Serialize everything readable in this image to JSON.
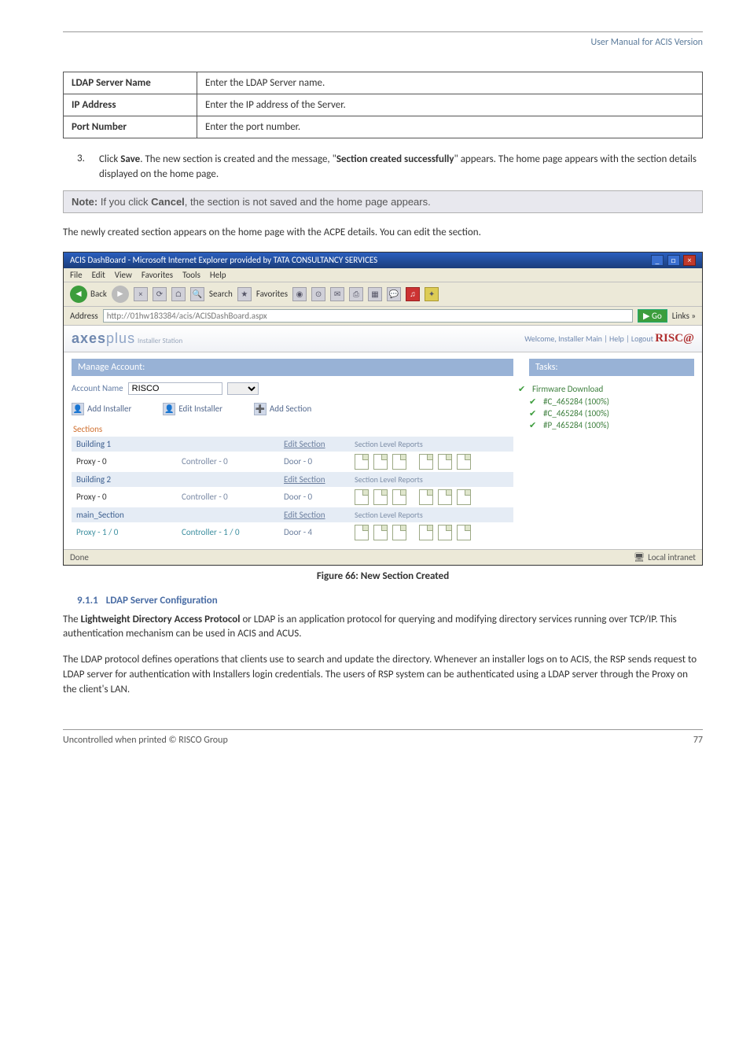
{
  "header": {
    "manual_title": "User Manual for ACIS Version"
  },
  "params": [
    {
      "name": "LDAP Server Name",
      "desc": "Enter the LDAP Server name."
    },
    {
      "name": "IP Address",
      "desc": "Enter the IP address of the Server."
    },
    {
      "name": "Port Number",
      "desc": "Enter the port number."
    }
  ],
  "step": {
    "num": "3.",
    "bold1": "Save",
    "mid": "The new section is created and the message,",
    "bold2": "Section created successfully",
    "tail": "appears. The home page appears with the section details displayed on the home page."
  },
  "note": {
    "label": "Note:",
    "pre": "If you click",
    "bold": "Cancel",
    "post": ", the section is not saved and the home page appears."
  },
  "para_after_note": "The newly created section appears on the home page with the ACPE details. You can edit the section.",
  "ss": {
    "title": "ACIS DashBoard - Microsoft Internet Explorer provided by TATA CONSULTANCY SERVICES",
    "menu": [
      "File",
      "Edit",
      "View",
      "Favorites",
      "Tools",
      "Help"
    ],
    "back": "Back",
    "search": "Search",
    "favorites": "Favorites",
    "address_label": "Address",
    "url": "http://01hw183384/acis/ACISDashBoard.aspx",
    "go": "Go",
    "links": "Links »",
    "brand_sub": "Installer Station",
    "welcome": "Welcome, Installer Main | Help | Logout",
    "risco": "RISC@",
    "manage_hdr": "Manage Account:",
    "acct_label": "Account Name",
    "acct_value": "RISCO",
    "add_installer": "Add Installer",
    "edit_installer": "Edit Installer",
    "add_section": "Add Section",
    "sections_hdr": "Sections",
    "edit_section": "Edit Section",
    "sec_reports": "Section Level Reports",
    "rows": [
      {
        "name": "Building 1",
        "proxy": "Proxy - 0",
        "ctrl": "Controller - 0",
        "door": "Door - 0"
      },
      {
        "name": "Building 2",
        "proxy": "Proxy - 0",
        "ctrl": "Controller - 0",
        "door": "Door - 0"
      },
      {
        "name": "main_Section",
        "proxy": "Proxy - 1 / 0",
        "ctrl": "Controller - 1 / 0",
        "door": "Door - 4"
      }
    ],
    "tasks_hdr": "Tasks:",
    "tasks": [
      "Firmware Download",
      "#C_465284 (100%)",
      "#C_465284 (100%)",
      "#P_465284 (100%)"
    ],
    "status_left": "Done",
    "status_right": "Local intranet"
  },
  "figure_caption": "Figure 66: New Section Created",
  "section": {
    "num": "9.1.1",
    "title": "LDAP Server Configuration"
  },
  "body": {
    "bold": "Lightweight Directory Access Protocol",
    "p1": "or LDAP is an application protocol for querying and modifying directory services running over TCP/IP. This authentication mechanism can be used in ACIS and ACUS.",
    "p2": "The LDAP protocol defines operations that clients use to search and update the directory. Whenever an installer logs on to ACIS, the RSP sends request to LDAP server for authentication with Installers login credentials. The users of RSP system can be authenticated using a LDAP server through the Proxy on the client's LAN."
  },
  "footer": {
    "left": "Uncontrolled when printed © RISCO Group",
    "page": "77"
  }
}
